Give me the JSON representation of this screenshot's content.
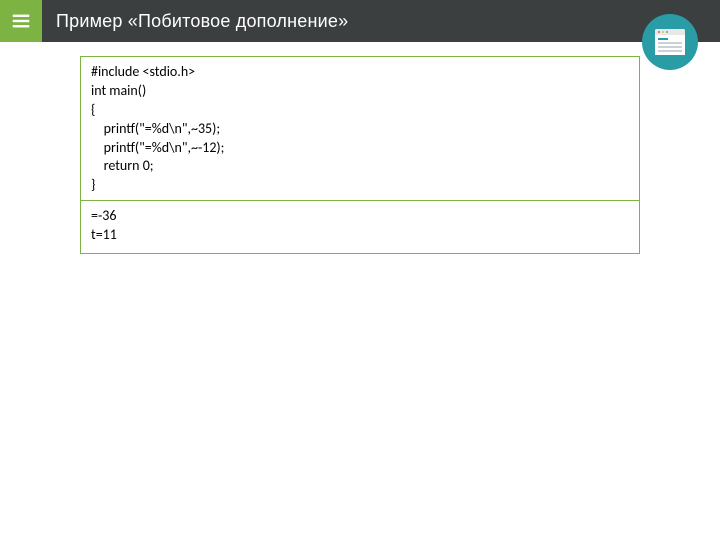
{
  "header": {
    "title": "Пример «Побитовое дополнение»"
  },
  "code": "#include <stdio.h>\nint main()\n{\n    printf(\"=%d\\n\",~35);\n    printf(\"=%d\\n\",~-12);\n    return 0;\n}",
  "output": "=-36\nt=11"
}
